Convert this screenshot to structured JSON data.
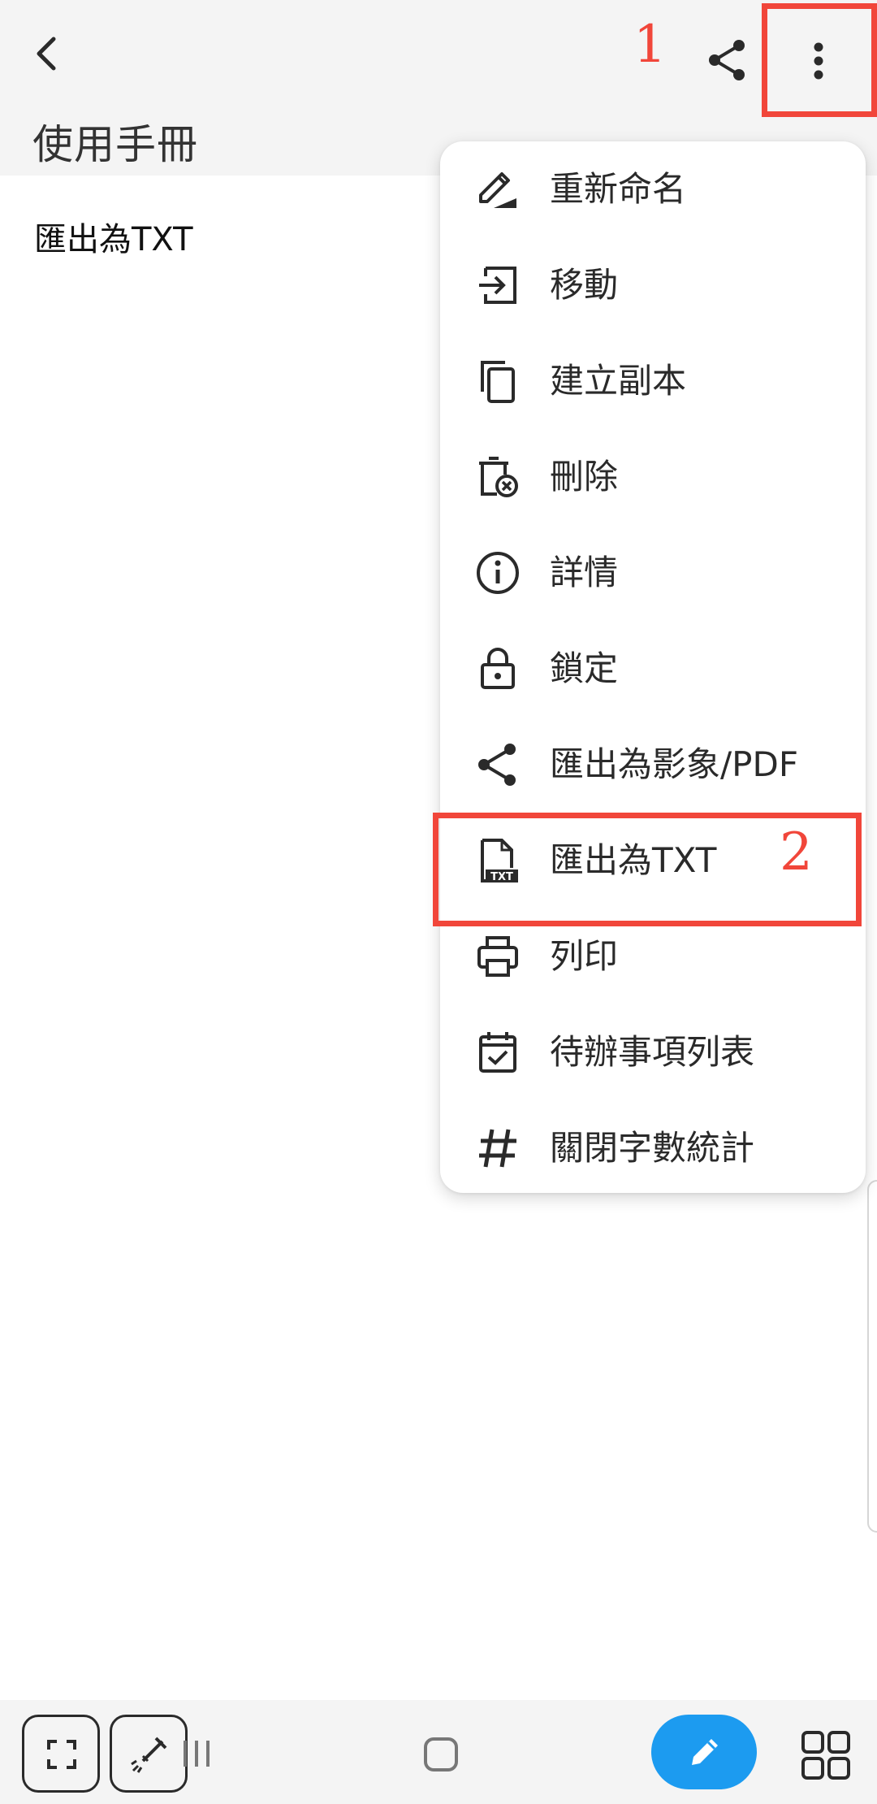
{
  "header": {
    "title": "使用手冊",
    "back_icon": "back-arrow-icon",
    "share_icon": "share-icon",
    "more_icon": "more-vertical-icon"
  },
  "note": {
    "content": "匯出為TXT"
  },
  "menu": {
    "items": [
      {
        "label": "重新命名",
        "icon": "rename-icon"
      },
      {
        "label": "移動",
        "icon": "move-icon"
      },
      {
        "label": "建立副本",
        "icon": "copy-icon"
      },
      {
        "label": "刪除",
        "icon": "delete-icon"
      },
      {
        "label": "詳情",
        "icon": "info-icon"
      },
      {
        "label": "鎖定",
        "icon": "lock-icon"
      },
      {
        "label": "匯出為影象/PDF",
        "icon": "share-icon"
      },
      {
        "label": "匯出為TXT",
        "icon": "txt-file-icon"
      },
      {
        "label": "列印",
        "icon": "print-icon"
      },
      {
        "label": "待辦事項列表",
        "icon": "checklist-calendar-icon"
      },
      {
        "label": "關閉字數統計",
        "icon": "hash-icon"
      }
    ]
  },
  "annotations": {
    "step1": "1",
    "step2": "2",
    "color": "#f1463a"
  },
  "bottom_bar": {
    "fab_color": "#1c9bf0",
    "icons": [
      "fullscreen-icon",
      "brush-icon",
      "recents-icon",
      "home-icon",
      "pen-icon",
      "grid-icon"
    ]
  }
}
